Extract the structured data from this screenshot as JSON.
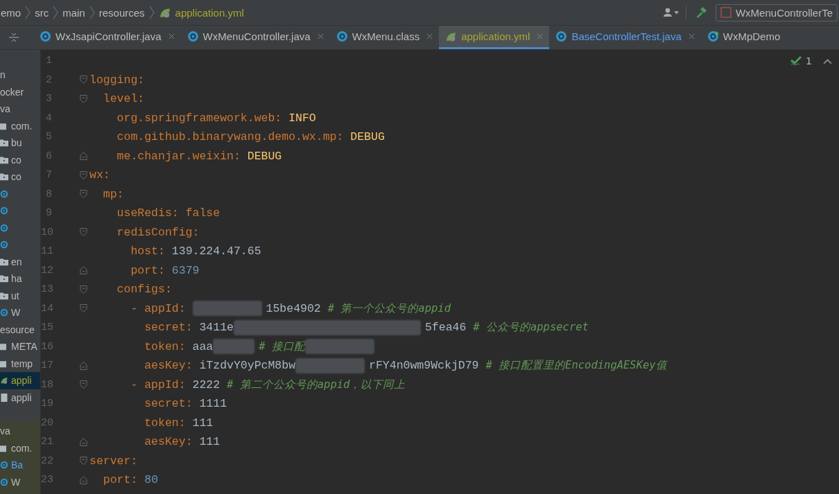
{
  "breadcrumb": [
    {
      "text": "emo",
      "kind": "project"
    },
    {
      "text": "src",
      "kind": "folder"
    },
    {
      "text": "main",
      "kind": "folder"
    },
    {
      "text": "resources",
      "kind": "folder"
    },
    {
      "text": "application.yml",
      "kind": "yaml"
    }
  ],
  "run_config": {
    "label": "WxMenuControllerTe"
  },
  "tabs": [
    {
      "label": "WxJsapiController.java",
      "kind": "class",
      "selected": false,
      "closable": true
    },
    {
      "label": "WxMenuController.java",
      "kind": "class",
      "selected": false,
      "closable": true
    },
    {
      "label": "WxMenu.class",
      "kind": "compiled",
      "selected": false,
      "closable": true
    },
    {
      "label": "application.yml",
      "kind": "yaml",
      "selected": true,
      "closable": true
    },
    {
      "label": "BaseControllerTest.java",
      "kind": "test",
      "selected": false,
      "closable": true
    },
    {
      "label": "WxMpDemo",
      "kind": "app",
      "selected": false,
      "closable": false
    }
  ],
  "project_tree": [
    {
      "text": "n",
      "kind": "plain",
      "selected": false
    },
    {
      "text": "ocker",
      "kind": "plain",
      "selected": false
    },
    {
      "text": "va",
      "kind": "plain",
      "selected": false
    },
    {
      "text": "com.",
      "kind": "package",
      "selected": false
    },
    {
      "text": "bu",
      "kind": "folder",
      "selected": false
    },
    {
      "text": "co",
      "kind": "folder",
      "selected": false
    },
    {
      "text": "co",
      "kind": "folder",
      "selected": false
    },
    {
      "kind": "class",
      "selected": false
    },
    {
      "kind": "class",
      "selected": false
    },
    {
      "kind": "class",
      "selected": false
    },
    {
      "kind": "class",
      "selected": false
    },
    {
      "text": "en",
      "kind": "folder",
      "selected": false
    },
    {
      "text": "ha",
      "kind": "folder",
      "selected": false
    },
    {
      "text": "ut",
      "kind": "folder",
      "selected": false
    },
    {
      "text": "W",
      "kind": "app",
      "selected": false
    },
    {
      "text": "esource",
      "kind": "plain",
      "selected": false
    },
    {
      "text": "META",
      "kind": "package",
      "selected": false
    },
    {
      "text": "temp",
      "kind": "package",
      "selected": false
    },
    {
      "text": "appli",
      "kind": "yaml",
      "selected": true
    },
    {
      "text": "appli",
      "kind": "file",
      "selected": false
    }
  ],
  "test_tree": [
    {
      "text": "va",
      "kind": "plain"
    },
    {
      "text": "com.",
      "kind": "package"
    },
    {
      "text": "Ba",
      "kind": "test"
    },
    {
      "text": "W",
      "kind": "app"
    }
  ],
  "inspections": {
    "count": "1"
  },
  "lines": [
    {
      "n": "1",
      "kind": "plain"
    },
    {
      "n": "2",
      "kind": "fold-start",
      "parts": [
        {
          "kind": "key",
          "text": "logging"
        },
        {
          "kind": "punct",
          "text": ":"
        }
      ]
    },
    {
      "n": "3",
      "kind": "fold-start",
      "parts": [
        {
          "kind": "key",
          "text": "  level"
        },
        {
          "kind": "punct",
          "text": ":"
        }
      ]
    },
    {
      "n": "4",
      "kind": "plain",
      "parts": [
        {
          "kind": "key",
          "text": "    org.springframework.web"
        },
        {
          "kind": "punct",
          "text": ": "
        },
        {
          "kind": "constant",
          "text": "INFO"
        }
      ]
    },
    {
      "n": "5",
      "kind": "plain",
      "parts": [
        {
          "kind": "key",
          "text": "    com.github.binarywang.demo.wx.mp"
        },
        {
          "kind": "punct",
          "text": ": "
        },
        {
          "kind": "constant",
          "text": "DEBUG"
        }
      ]
    },
    {
      "n": "6",
      "kind": "fold-end",
      "parts": [
        {
          "kind": "key",
          "text": "    me.chanjar.weixin"
        },
        {
          "kind": "punct",
          "text": ": "
        },
        {
          "kind": "constant",
          "text": "DEBUG"
        }
      ]
    },
    {
      "n": "7",
      "kind": "fold-start",
      "parts": [
        {
          "kind": "key",
          "text": "wx"
        },
        {
          "kind": "punct",
          "text": ":"
        }
      ]
    },
    {
      "n": "8",
      "kind": "fold-start",
      "parts": [
        {
          "kind": "key",
          "text": "  mp"
        },
        {
          "kind": "punct",
          "text": ":"
        }
      ]
    },
    {
      "n": "9",
      "kind": "plain",
      "parts": [
        {
          "kind": "key",
          "text": "    useRedis"
        },
        {
          "kind": "punct",
          "text": ": "
        },
        {
          "kind": "keyword",
          "text": "false"
        }
      ]
    },
    {
      "n": "10",
      "kind": "fold-start",
      "parts": [
        {
          "kind": "key",
          "text": "    redisConfig"
        },
        {
          "kind": "punct",
          "text": ":"
        }
      ]
    },
    {
      "n": "11",
      "kind": "plain",
      "parts": [
        {
          "kind": "key",
          "text": "      host"
        },
        {
          "kind": "punct",
          "text": ": "
        },
        {
          "kind": "value",
          "text": "139.224.47.65"
        }
      ]
    },
    {
      "n": "12",
      "kind": "fold-end",
      "parts": [
        {
          "kind": "key",
          "text": "      port"
        },
        {
          "kind": "punct",
          "text": ": "
        },
        {
          "kind": "number",
          "text": "6379"
        }
      ]
    },
    {
      "n": "13",
      "kind": "fold-start",
      "parts": [
        {
          "kind": "key",
          "text": "    configs"
        },
        {
          "kind": "punct",
          "text": ":"
        }
      ]
    },
    {
      "n": "14",
      "kind": "fold-start",
      "parts": [
        {
          "kind": "punct",
          "text": "      - "
        },
        {
          "kind": "key",
          "text": "appId"
        },
        {
          "kind": "punct",
          "text": ": "
        },
        {
          "kind": "redacted-long"
        },
        {
          "kind": "value",
          "text": "15be4902 "
        },
        {
          "kind": "comment",
          "text": "# 第一个公众号的appid"
        }
      ]
    },
    {
      "n": "15",
      "kind": "plain",
      "parts": [
        {
          "kind": "key",
          "text": "        secret"
        },
        {
          "kind": "punct",
          "text": ": "
        },
        {
          "kind": "value",
          "text": "3411e"
        },
        {
          "kind": "redacted-wide"
        },
        {
          "kind": "value",
          "text": "5fea46 "
        },
        {
          "kind": "comment",
          "text": "# 公众号的appsecret"
        }
      ]
    },
    {
      "n": "16",
      "kind": "plain",
      "parts": [
        {
          "kind": "key",
          "text": "        token"
        },
        {
          "kind": "punct",
          "text": ": "
        },
        {
          "kind": "value",
          "text": "aaa"
        },
        {
          "kind": "redacted-short"
        },
        {
          "kind": "comment",
          "text": "# 接口配"
        },
        {
          "kind": "redacted-long"
        }
      ]
    },
    {
      "n": "17",
      "kind": "fold-end",
      "parts": [
        {
          "kind": "key",
          "text": "        aesKey"
        },
        {
          "kind": "punct",
          "text": ": "
        },
        {
          "kind": "value",
          "text": "iTzdvY0yPcM8bw"
        },
        {
          "kind": "redacted-long"
        },
        {
          "kind": "value",
          "text": "rFY4n0wm9WckjD79 "
        },
        {
          "kind": "comment",
          "text": "# 接口配置里的EncodingAESKey值"
        }
      ]
    },
    {
      "n": "18",
      "kind": "fold-start",
      "parts": [
        {
          "kind": "punct",
          "text": "      - "
        },
        {
          "kind": "key",
          "text": "appId"
        },
        {
          "kind": "punct",
          "text": ": "
        },
        {
          "kind": "value",
          "text": "2222 "
        },
        {
          "kind": "comment",
          "text": "# 第二个公众号的appid，以下同上"
        }
      ]
    },
    {
      "n": "19",
      "kind": "plain",
      "parts": [
        {
          "kind": "key",
          "text": "        secret"
        },
        {
          "kind": "punct",
          "text": ": "
        },
        {
          "kind": "value",
          "text": "1111"
        }
      ]
    },
    {
      "n": "20",
      "kind": "plain",
      "parts": [
        {
          "kind": "key",
          "text": "        token"
        },
        {
          "kind": "punct",
          "text": ": "
        },
        {
          "kind": "value",
          "text": "111"
        }
      ]
    },
    {
      "n": "21",
      "kind": "fold-end",
      "parts": [
        {
          "kind": "key",
          "text": "        aesKey"
        },
        {
          "kind": "punct",
          "text": ": "
        },
        {
          "kind": "value",
          "text": "111"
        }
      ]
    },
    {
      "n": "22",
      "kind": "fold-start",
      "parts": [
        {
          "kind": "key",
          "text": "server"
        },
        {
          "kind": "punct",
          "text": ":"
        }
      ]
    },
    {
      "n": "23",
      "kind": "fold-end",
      "parts": [
        {
          "kind": "key",
          "text": "  port"
        },
        {
          "kind": "punct",
          "text": ": "
        },
        {
          "kind": "number",
          "text": "80"
        }
      ]
    }
  ]
}
